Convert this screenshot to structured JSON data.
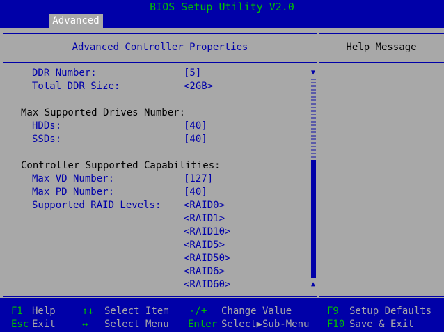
{
  "window": {
    "title": "BIOS Setup Utility V2.0"
  },
  "tabs": [
    {
      "label": "Advanced"
    }
  ],
  "left_panel": {
    "header": "Advanced Controller Properties",
    "rows": [
      {
        "label": "DDR Number:",
        "value": "[5]"
      },
      {
        "label": "Total DDR Size:",
        "value": "<2GB>"
      },
      {
        "section": "Max Supported Drives Number:"
      },
      {
        "label": "HDDs:",
        "value": "[40]"
      },
      {
        "label": "SSDs:",
        "value": "[40]"
      },
      {
        "section": "Controller Supported Capabilities:"
      },
      {
        "label": "Max VD Number:",
        "value": "[127]"
      },
      {
        "label": "Max PD Number:",
        "value": "[40]"
      },
      {
        "label": "Supported RAID Levels:",
        "value": "<RAID0>"
      },
      {
        "value": "<RAID1>"
      },
      {
        "value": "<RAID10>"
      },
      {
        "value": "<RAID5>"
      },
      {
        "value": "<RAID50>"
      },
      {
        "value": "<RAID6>"
      },
      {
        "value": "<RAID60>"
      }
    ]
  },
  "right_panel": {
    "header": "Help Message"
  },
  "scrollbar": {
    "up_glyph": "▲",
    "down_glyph": "▼"
  },
  "footer": [
    {
      "key": "F1",
      "desc": "Help"
    },
    {
      "key": "Esc",
      "desc": "Exit"
    },
    {
      "key": "↑↓",
      "desc": "Select Item"
    },
    {
      "key": "↔",
      "desc": "Select Menu"
    },
    {
      "key": "-/+",
      "desc": "Change Value"
    },
    {
      "key": "Enter",
      "desc": "Select▶Sub-Menu"
    },
    {
      "key": "F9",
      "desc": "Setup Defaults"
    },
    {
      "key": "F10",
      "desc": "Save & Exit"
    }
  ],
  "colors": {
    "background": "#0000a8",
    "panel": "#a8a8a8",
    "key": "#00c000",
    "text": "#0000a8"
  }
}
